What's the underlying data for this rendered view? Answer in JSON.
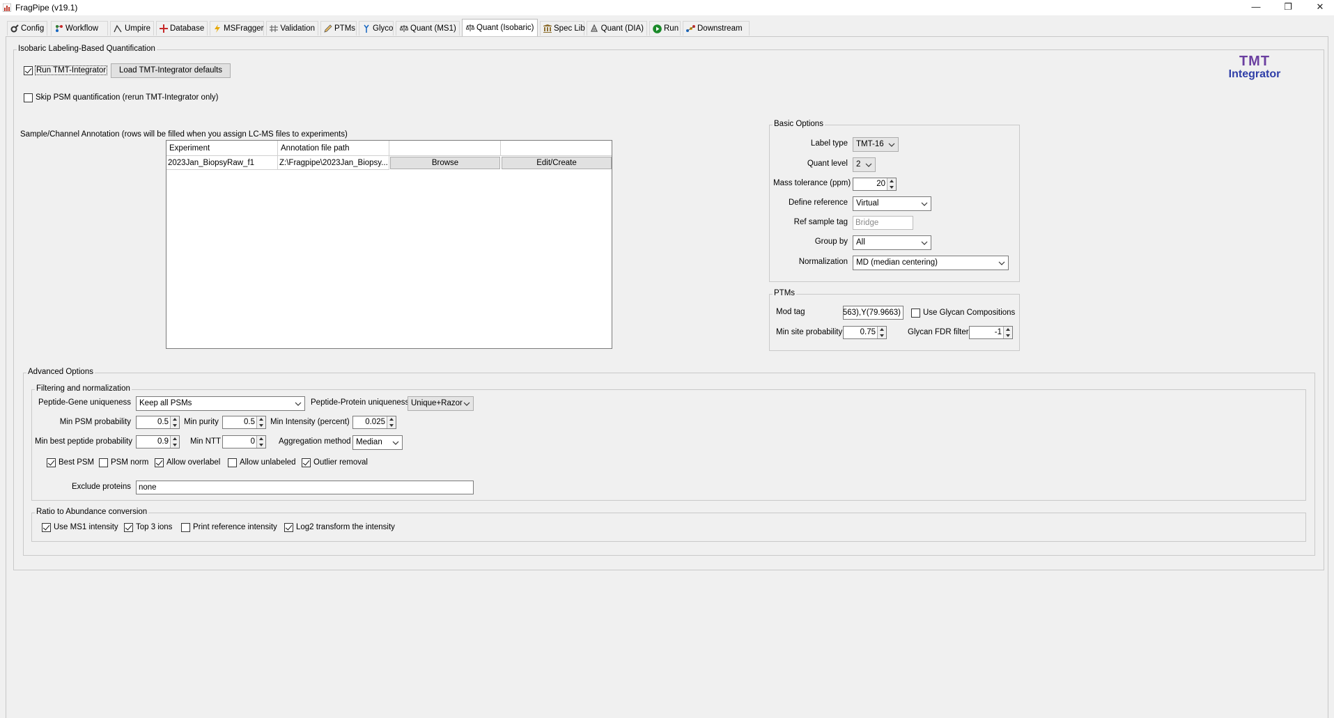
{
  "window": {
    "title": "FragPipe (v19.1)",
    "minimize": "—",
    "restore": "❐",
    "close": "✕"
  },
  "tabs": [
    {
      "label": "Config",
      "icon": "gear-icon"
    },
    {
      "label": "Workflow",
      "icon": "workflow-icon"
    },
    {
      "label": "Umpire",
      "icon": "umpire-icon"
    },
    {
      "label": "Database",
      "icon": "database-icon"
    },
    {
      "label": "MSFragger",
      "icon": "lightning-icon"
    },
    {
      "label": "Validation",
      "icon": "validation-icon"
    },
    {
      "label": "PTMs",
      "icon": "pencil-icon"
    },
    {
      "label": "Glyco",
      "icon": "glyco-icon"
    },
    {
      "label": "Quant (MS1)",
      "icon": "scale-icon"
    },
    {
      "label": "Quant (Isobaric)",
      "icon": "scale-icon",
      "active": true
    },
    {
      "label": "Spec Lib",
      "icon": "library-icon"
    },
    {
      "label": "Quant (DIA)",
      "icon": "dia-icon"
    },
    {
      "label": "Run",
      "icon": "play-icon"
    },
    {
      "label": "Downstream",
      "icon": "downstream-icon"
    }
  ],
  "isobaric": {
    "legend": "Isobaric Labeling-Based Quantification",
    "run_tmt_label": "Run TMT-Integrator",
    "run_tmt_checked": true,
    "load_defaults_label": "Load TMT-Integrator defaults",
    "skip_psm_label": "Skip PSM quantification (rerun TMT-Integrator only)",
    "skip_psm_checked": false,
    "logo_line1": "TMT",
    "logo_line2": "Integrator"
  },
  "annotation": {
    "caption": "Sample/Channel Annotation (rows will be filled when you assign LC-MS files to experiments)",
    "columns": [
      "Experiment",
      "Annotation file path",
      "",
      ""
    ],
    "rows": [
      {
        "experiment": "2023Jan_BiopsyRaw_f1",
        "path": "Z:\\Fragpipe\\2023Jan_Biopsy...",
        "browse": "Browse",
        "edit": "Edit/Create"
      }
    ]
  },
  "basic": {
    "legend": "Basic Options",
    "label_type_label": "Label type",
    "label_type": "TMT-16",
    "quant_level_label": "Quant level",
    "quant_level": "2",
    "mass_tol_label": "Mass tolerance (ppm)",
    "mass_tol": "20",
    "define_ref_label": "Define reference",
    "define_ref": "Virtual",
    "ref_tag_label": "Ref sample tag",
    "ref_tag": "Bridge",
    "group_by_label": "Group by",
    "group_by": "All",
    "normalization_label": "Normalization",
    "normalization": "MD (median centering)"
  },
  "ptms": {
    "legend": "PTMs",
    "mod_tag_label": "Mod tag",
    "mod_tag": "563),Y(79.9663)",
    "use_glycan_label": "Use Glycan Compositions",
    "use_glycan_checked": false,
    "min_site_label": "Min site probability",
    "min_site": "0.75",
    "glycan_fdr_label": "Glycan FDR filter",
    "glycan_fdr": "-1"
  },
  "advanced": {
    "legend": "Advanced Options",
    "filtering_legend": "Filtering and normalization",
    "pep_gene_label": "Peptide-Gene uniqueness",
    "pep_gene": "Keep all PSMs",
    "pep_prot_label": "Peptide-Protein uniqueness",
    "pep_prot": "Unique+Razor",
    "min_psm_label": "Min PSM probability",
    "min_psm": "0.5",
    "min_purity_label": "Min purity",
    "min_purity": "0.5",
    "min_intensity_label": "Min Intensity (percent)",
    "min_intensity": "0.025",
    "min_best_pep_label": "Min best peptide probability",
    "min_best_pep": "0.9",
    "min_ntt_label": "Min NTT",
    "min_ntt": "0",
    "aggregation_label": "Aggregation method",
    "aggregation": "Median",
    "best_psm_label": "Best PSM",
    "best_psm_checked": true,
    "psm_norm_label": "PSM norm",
    "psm_norm_checked": false,
    "allow_overlabel_label": "Allow overlabel",
    "allow_overlabel_checked": true,
    "allow_unlabeled_label": "Allow unlabeled",
    "allow_unlabeled_checked": false,
    "outlier_label": "Outlier removal",
    "outlier_checked": true,
    "exclude_label": "Exclude proteins",
    "exclude": "none",
    "ratio_legend": "Ratio to Abundance conversion",
    "ms1_label": "Use MS1 intensity",
    "ms1_checked": true,
    "top3_label": "Top 3 ions",
    "top3_checked": true,
    "print_ref_label": "Print reference intensity",
    "print_ref_checked": false,
    "log2_label": "Log2 transform the intensity",
    "log2_checked": true
  }
}
